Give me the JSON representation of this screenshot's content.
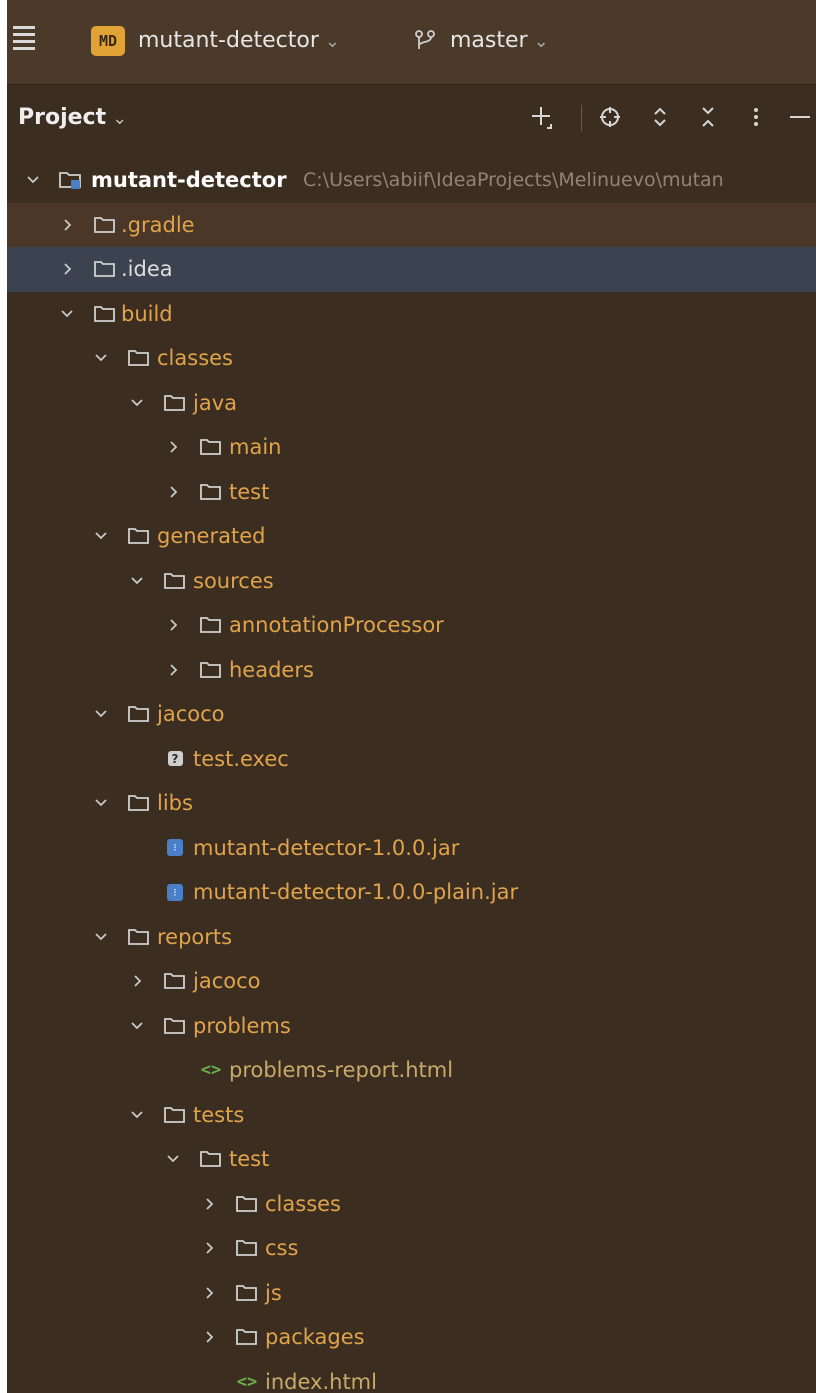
{
  "titlebar": {
    "project_badge": "MD",
    "project_name": "mutant-detector",
    "branch_name": "master"
  },
  "toolwindow": {
    "title": "Project"
  },
  "tree": {
    "root": {
      "name": "mutant-detector",
      "path": "C:\\Users\\abiif\\IdeaProjects\\Melinuevo\\mutan"
    },
    "items": [
      {
        "label": ".gradle"
      },
      {
        "label": ".idea"
      },
      {
        "label": "build"
      },
      {
        "label": "classes"
      },
      {
        "label": "java"
      },
      {
        "label": "main"
      },
      {
        "label": "test"
      },
      {
        "label": "generated"
      },
      {
        "label": "sources"
      },
      {
        "label": "annotationProcessor"
      },
      {
        "label": "headers"
      },
      {
        "label": "jacoco"
      },
      {
        "label": "test.exec"
      },
      {
        "label": "libs"
      },
      {
        "label": "mutant-detector-1.0.0.jar"
      },
      {
        "label": "mutant-detector-1.0.0-plain.jar"
      },
      {
        "label": "reports"
      },
      {
        "label": "jacoco"
      },
      {
        "label": "problems"
      },
      {
        "label": "problems-report.html"
      },
      {
        "label": "tests"
      },
      {
        "label": "test"
      },
      {
        "label": "classes"
      },
      {
        "label": "css"
      },
      {
        "label": "js"
      },
      {
        "label": "packages"
      },
      {
        "label": "index.html"
      }
    ]
  },
  "colors": {
    "background": "#3b2e21",
    "titlebar": "#4b3a2a",
    "folder_label": "#e0a34a",
    "selected_row": "#3b4250",
    "badge": "#e1a336",
    "jar_icon": "#4a7fc9",
    "html_icon": "#6ab04c"
  }
}
